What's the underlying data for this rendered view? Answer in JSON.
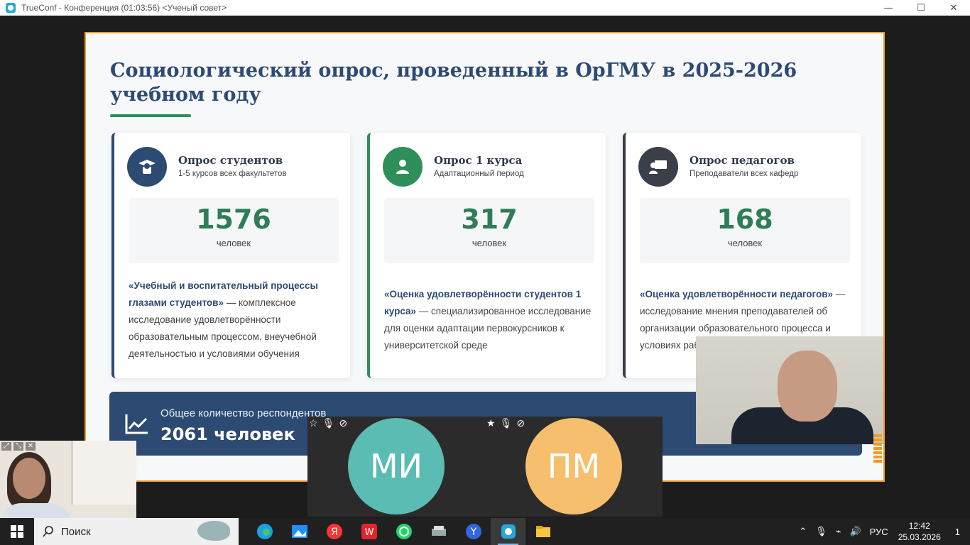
{
  "window": {
    "title": "TrueConf - Конференция (01:03:56) <Ученый совет>",
    "minimize": "—",
    "maximize": "☐",
    "close": "✕"
  },
  "slide": {
    "title": "Социологический опрос, проведенный в ОрГМУ в 2025-2026 учебном году",
    "cards": [
      {
        "title": "Опрос студентов",
        "subtitle": "1-5 курсов всех факультетов",
        "count": "1576",
        "unit": "человек",
        "desc_bold": "«Учебный и воспитательный процессы глазами студентов»",
        "desc_rest": " — комплексное исследование удовлетворённости образовательным процессом, внеучебной деятельностью и условиями обучения",
        "icon": "graduate-icon"
      },
      {
        "title": "Опрос 1 курса",
        "subtitle": "Адаптационный период",
        "count": "317",
        "unit": "человек",
        "desc_bold": "«Оценка удовлетворённости студентов 1 курса»",
        "desc_rest": " — специализированное исследование для оценки адаптации первокурсников к университетской среде",
        "icon": "user-icon"
      },
      {
        "title": "Опрос педагогов",
        "subtitle": "Преподаватели всех кафедр",
        "count": "168",
        "unit": "человек",
        "desc_bold": "«Оценка удовлетворённости педагогов»",
        "desc_rest": " — исследование мнения преподавателей об организации образовательного процесса и условиях работы",
        "icon": "teacher-board-icon"
      }
    ],
    "summary": {
      "label": "Общее количество респондентов",
      "value": "2061 человек"
    }
  },
  "participants": [
    {
      "initials": "МИ",
      "color": "#5bbcb3"
    },
    {
      "initials": "ПМ",
      "color": "#f5bf6e"
    }
  ],
  "taskbar": {
    "search_label": "Поиск",
    "language": "РУС",
    "time": "12:42",
    "date": "25.03.2026",
    "notifications": "1"
  }
}
